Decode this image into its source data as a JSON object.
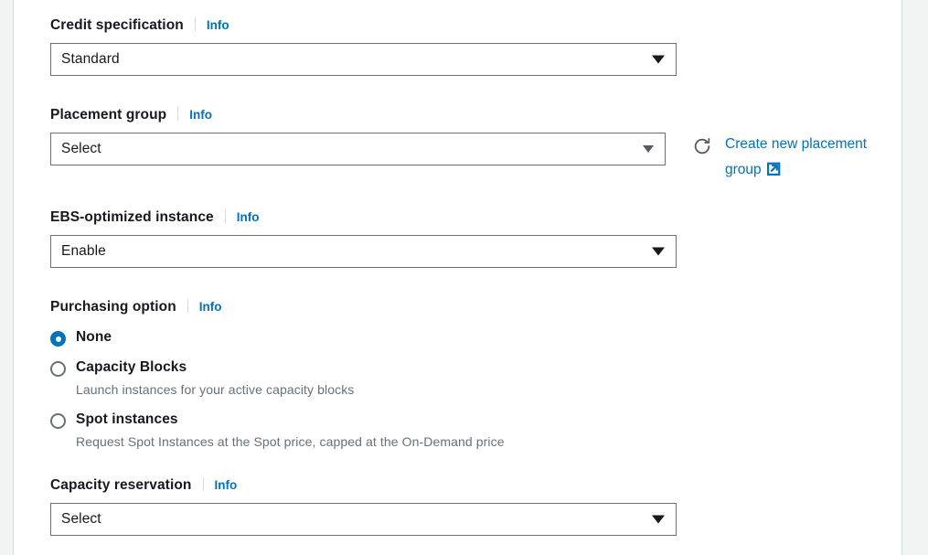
{
  "theme": {
    "page_background": "#f2f3f3",
    "panel_background": "#ffffff",
    "panel_border": "#d5dbdb",
    "text_primary": "#16191f",
    "text_secondary": "#687078",
    "link_blue": "#0073bb",
    "control_border": "#687078",
    "radio_selected": "#0073bb",
    "icon_gray": "#545b64"
  },
  "form": {
    "credit_specification": {
      "label": "Credit specification",
      "info_label": "Info",
      "select": {
        "name": "credit-specification-select",
        "value": "Standard",
        "caret_icon": "caret-down-icon"
      }
    },
    "placement_group": {
      "label": "Placement group",
      "info_label": "Info",
      "select": {
        "name": "placement-group-select",
        "value": "Select",
        "caret_icon": "caret-down-icon"
      },
      "side_action": {
        "refresh_icon": "refresh-icon",
        "link_text": "Create new placement group",
        "external_icon": "external-link-icon"
      }
    },
    "ebs_optimized_instance": {
      "label": "EBS-optimized instance",
      "info_label": "Info",
      "select": {
        "name": "ebs-optimized-select",
        "value": "Enable",
        "caret_icon": "caret-down-icon"
      }
    },
    "purchasing_option": {
      "label": "Purchasing option",
      "info_label": "Info",
      "options": [
        {
          "id": "none",
          "label": "None",
          "description": "",
          "selected": true
        },
        {
          "id": "capacity-blocks",
          "label": "Capacity Blocks",
          "description": "Launch instances for your active capacity blocks",
          "selected": false
        },
        {
          "id": "spot-instances",
          "label": "Spot instances",
          "description": "Request Spot Instances at the Spot price, capped at the On-Demand price",
          "selected": false
        }
      ]
    },
    "capacity_reservation": {
      "label": "Capacity reservation",
      "info_label": "Info",
      "select": {
        "name": "capacity-reservation-select",
        "value": "Select",
        "caret_icon": "caret-down-icon"
      }
    }
  }
}
